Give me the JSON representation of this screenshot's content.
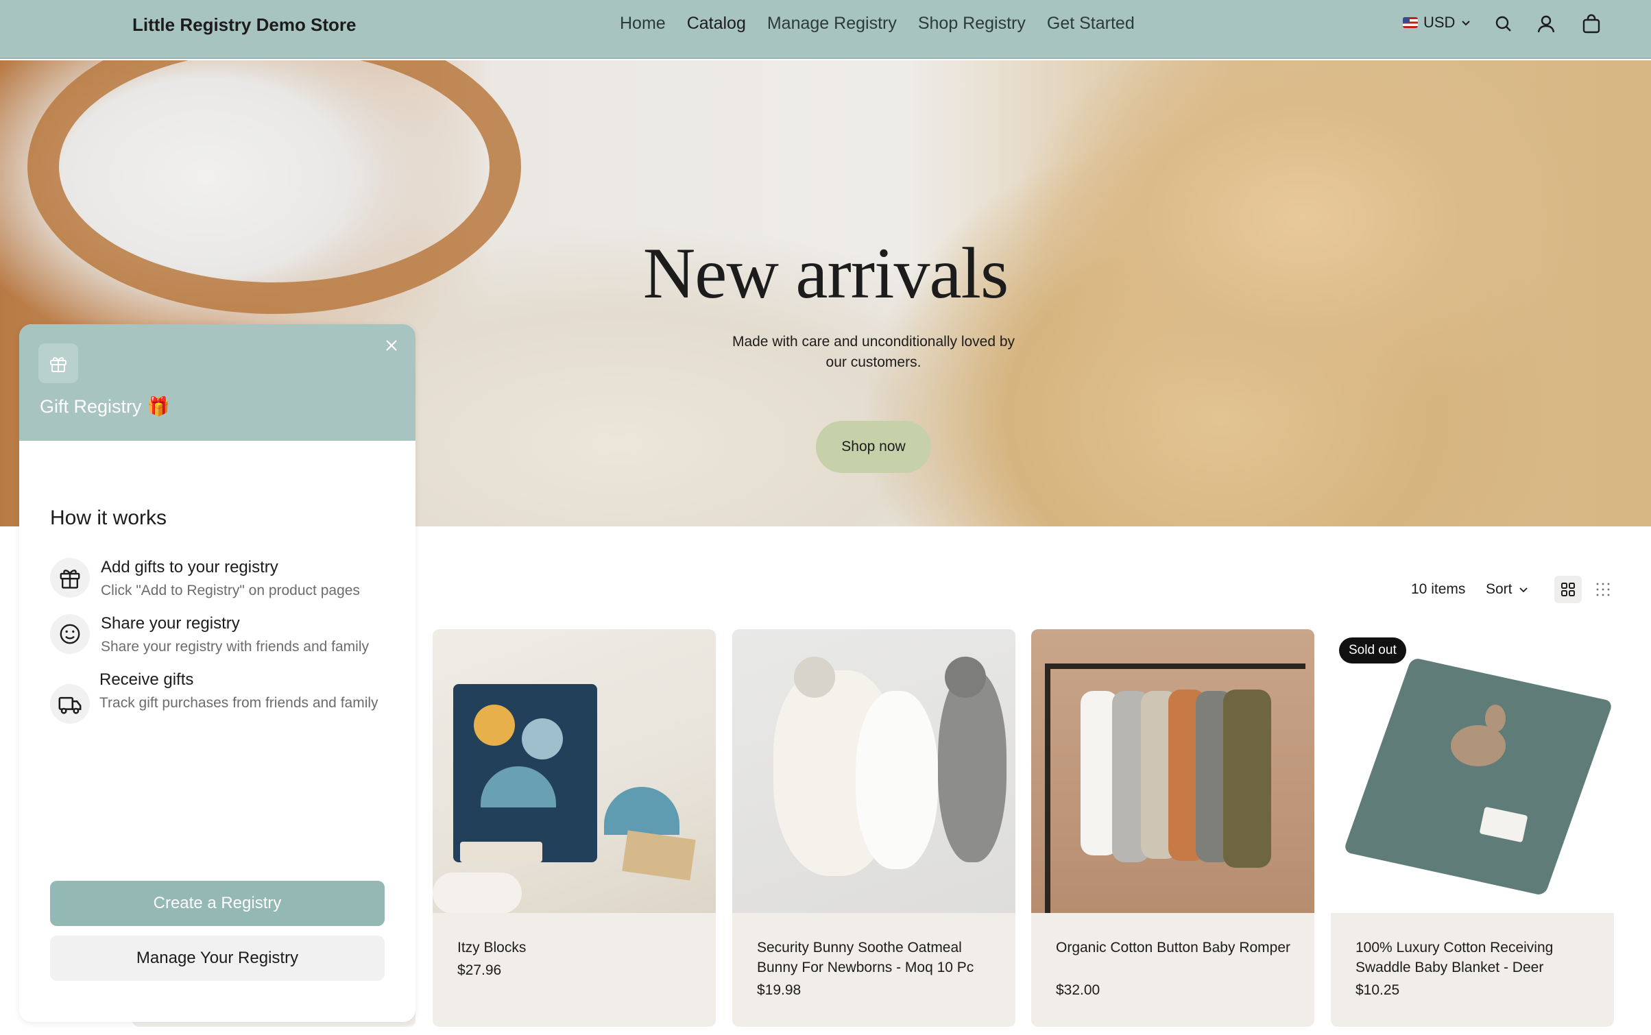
{
  "header": {
    "logo": "Little Registry Demo Store",
    "nav": [
      "Home",
      "Catalog",
      "Manage Registry",
      "Shop Registry",
      "Get Started"
    ],
    "currency": "USD",
    "icons": [
      "search-icon",
      "account-icon",
      "cart-icon"
    ]
  },
  "hero": {
    "title": "New arrivals",
    "subtitle": "Made with care and unconditionally loved by our customers.",
    "button": "Shop now"
  },
  "toolbar": {
    "items_count": "10 items",
    "sort_label": "Sort"
  },
  "products": [
    {
      "title": "Itzy Blocks",
      "price": "$27.96",
      "badge": ""
    },
    {
      "title": "Security Bunny Soothe Oatmeal Bunny For Newborns - Moq 10 Pc",
      "price": "$19.98",
      "badge": ""
    },
    {
      "title": "Organic Cotton Button Baby Romper",
      "price": "$32.00",
      "badge": ""
    },
    {
      "title": "100% Luxury Cotton Receiving Swaddle Baby Blanket - Deer",
      "price": "$10.25",
      "badge": "Sold out"
    }
  ],
  "registry_panel": {
    "title": "Gift Registry 🎁",
    "how_title": "How it works",
    "steps": [
      {
        "title": "Add gifts to your registry",
        "desc": "Click \"Add to Registry\" on product pages"
      },
      {
        "title": "Share your registry",
        "desc": "Share your registry with friends and family"
      },
      {
        "title": "Receive gifts",
        "desc": "Track gift purchases from friends and family"
      }
    ],
    "create_button": "Create a Registry",
    "manage_button": "Manage Your Registry"
  },
  "colors": {
    "header_bg": "#a8c4c0",
    "shop_button_bg": "#c6d0a9",
    "create_button_bg": "#94b8b3",
    "card_bg": "#f1eeea"
  }
}
